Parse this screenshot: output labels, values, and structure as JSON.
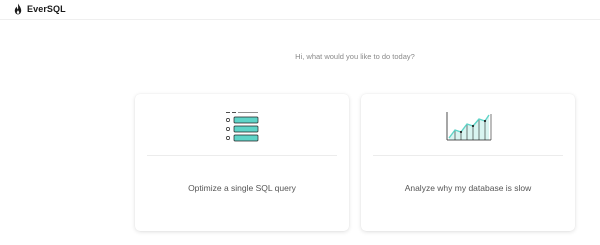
{
  "header": {
    "brand": "EverSQL"
  },
  "main": {
    "prompt": "Hi, what would you like to do today?",
    "cards": [
      {
        "label": "Optimize a single SQL query",
        "icon": "sql-query-list-icon"
      },
      {
        "label": "Analyze why my database is slow",
        "icon": "performance-chart-icon"
      }
    ]
  },
  "colors": {
    "accent": "#5fd4c8",
    "text_muted": "#8a8a8a",
    "card_text": "#555555"
  }
}
